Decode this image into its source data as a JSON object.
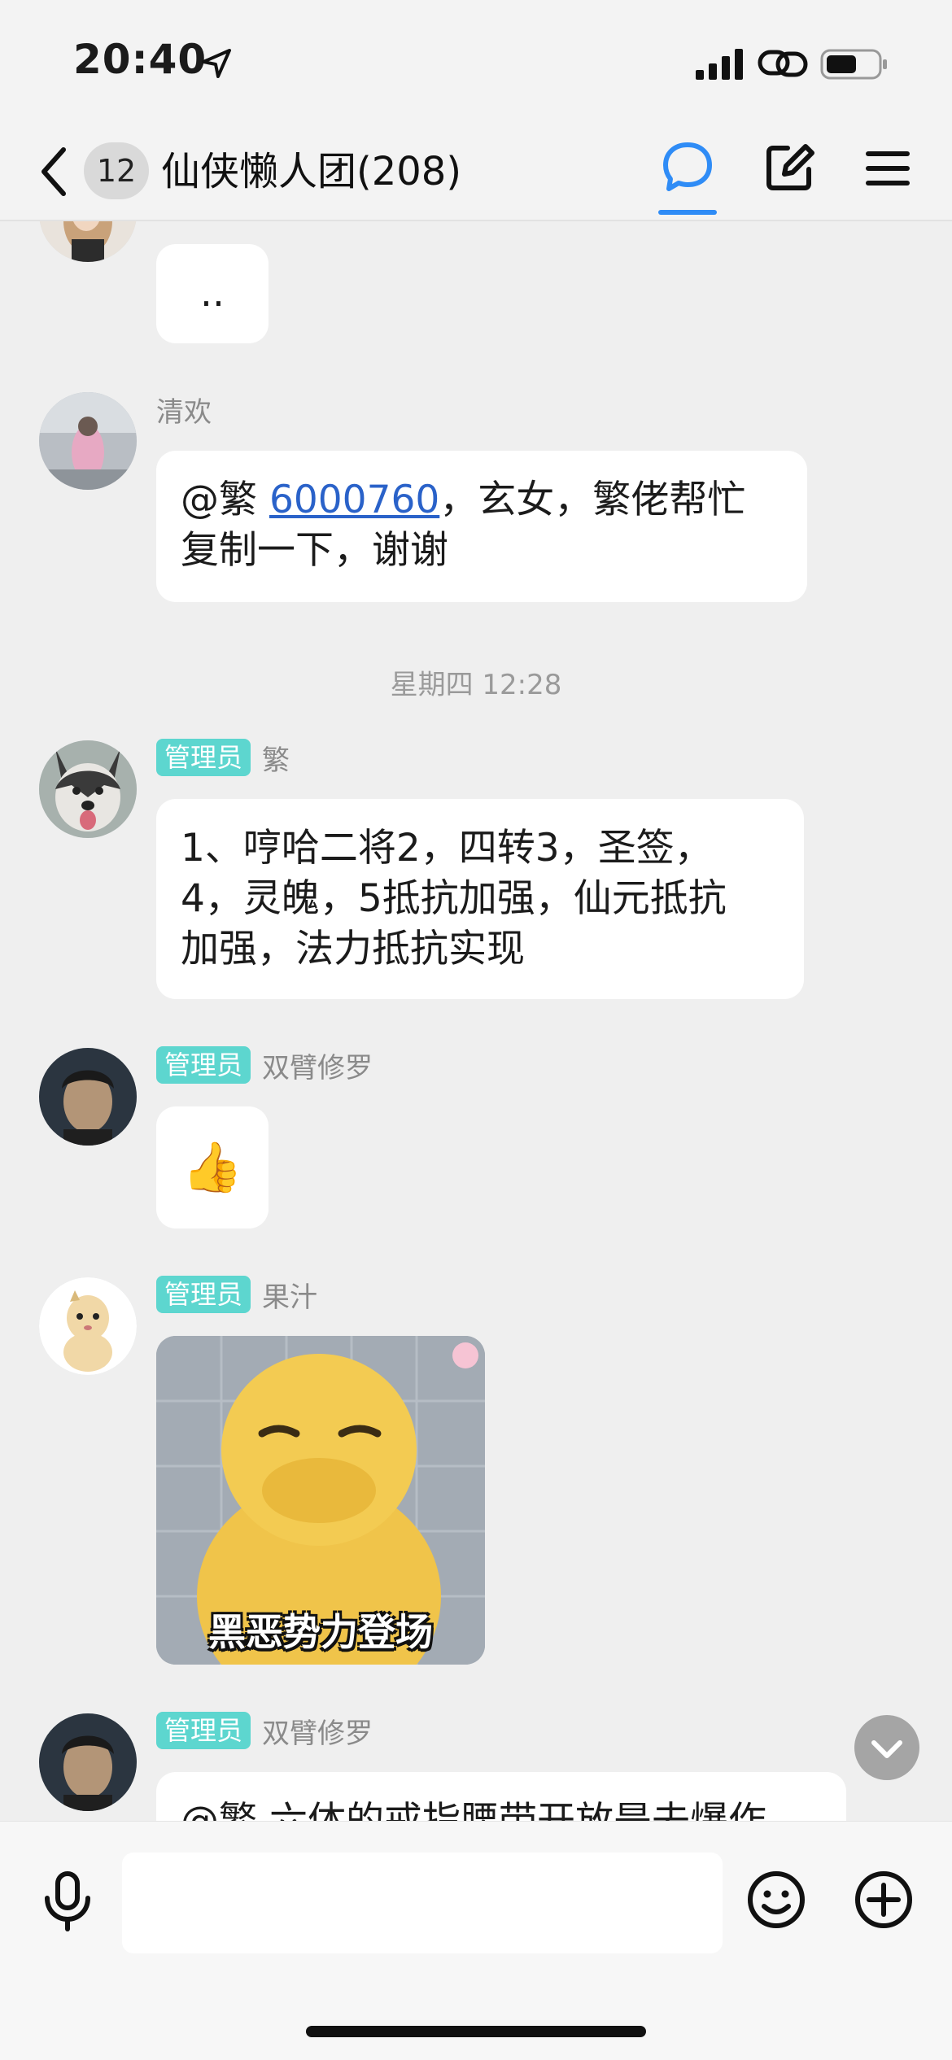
{
  "status_bar": {
    "time": "20:40",
    "icons": [
      "location-arrow-icon",
      "cellular-signal-icon",
      "link-icon",
      "battery-icon"
    ]
  },
  "nav": {
    "back_icon": "chevron-left-icon",
    "unread_count": "12",
    "title": "仙侠懒人团(208)",
    "icons": [
      "chat-bubble-icon",
      "edit-icon",
      "menu-icon"
    ],
    "accent_color": "#2f8cf6"
  },
  "messages": [
    {
      "sender": "",
      "text": ".."
    },
    {
      "sender": "清欢",
      "mention": "@繁 ",
      "link": "6000760",
      "text_line1_rest": "，玄女，繁佬帮忙",
      "text_line2": "复制一下，谢谢"
    },
    {
      "divider": "星期四 12:28"
    },
    {
      "admin": "管理员",
      "sender": "繁",
      "lines": [
        "1、哼哈二将2，四转3，圣签，",
        "4，灵魄，5抵抗加强，仙元抵抗",
        "加强，法力抵抗实现"
      ]
    },
    {
      "admin": "管理员",
      "sender": "双臂修罗",
      "emoji": "👍"
    },
    {
      "admin": "管理员",
      "sender": "果汁",
      "sticker_caption": "黑恶势力登场"
    },
    {
      "admin": "管理员",
      "sender": "双臂修罗",
      "text": "@繁 六体的戒指腰带开放是去爆作"
    }
  ],
  "colors": {
    "admin_tag": "#5dd6cf",
    "background": "#efefef",
    "bubble": "#ffffff",
    "link": "#2a62c9"
  },
  "input_bar": {
    "placeholder": "",
    "icons": [
      "microphone-icon",
      "emoji-icon",
      "plus-icon"
    ]
  }
}
